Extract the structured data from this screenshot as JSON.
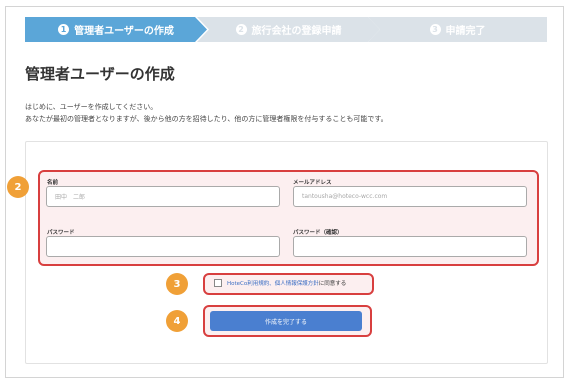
{
  "stepper": [
    {
      "num": "1",
      "label": "管理者ユーザーの作成",
      "state": "active"
    },
    {
      "num": "2",
      "label": "旅行会社の登録申請",
      "state": "inactive"
    },
    {
      "num": "3",
      "label": "申請完了",
      "state": "inactive"
    }
  ],
  "page_title": "管理者ユーザーの作成",
  "intro": {
    "line1": "はじめに、ユーザーを作成してください。",
    "line2": "あなたが最初の管理者となりますが、後から他の方を招待したり、他の方に管理者権限を付与することも可能です。"
  },
  "form": {
    "name": {
      "label": "名前",
      "placeholder": "田中　二郎"
    },
    "email": {
      "label": "メールアドレス",
      "placeholder": "tantousha@hoteco-wcc.com"
    },
    "password": {
      "label": "パスワード",
      "placeholder": ""
    },
    "password_confirm": {
      "label": "パスワード（確認）",
      "placeholder": ""
    }
  },
  "agreement": {
    "link_text": "HoteCo利用規約、個人情報保護方針",
    "suffix": "に同意する",
    "checked": false
  },
  "submit_label": "作成を完了する",
  "annotations": {
    "badge2": "2",
    "badge3": "3",
    "badge4": "4"
  },
  "colors": {
    "accent": "#5ba6d8",
    "button": "#4a7fd0",
    "badge": "#f0a037",
    "highlight": "#d83f3f"
  }
}
